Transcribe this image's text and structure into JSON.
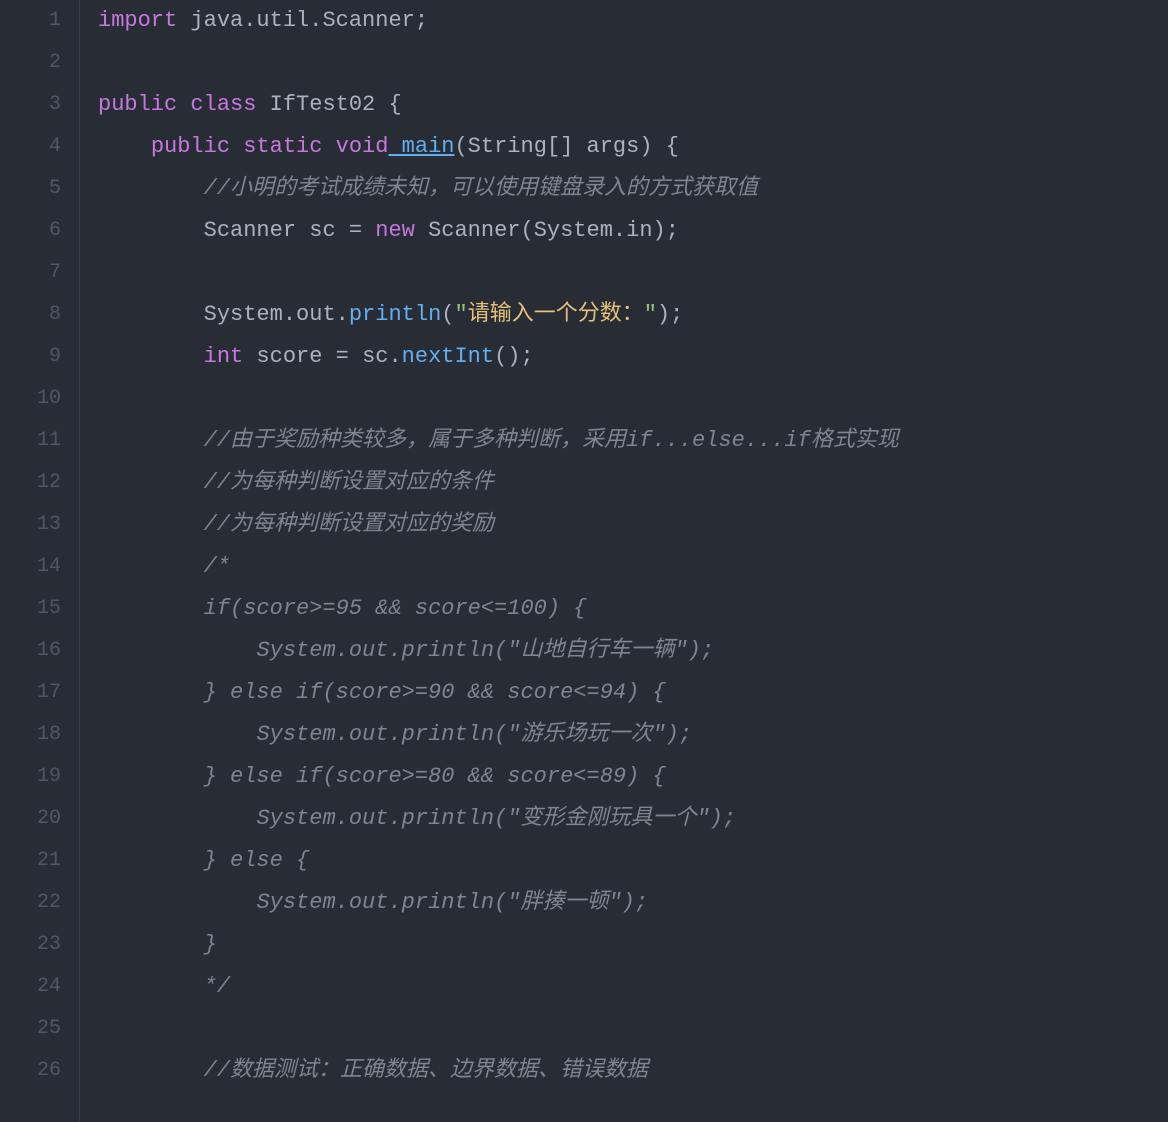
{
  "lines": [
    {
      "num": "1"
    },
    {
      "num": "2"
    },
    {
      "num": "3"
    },
    {
      "num": "4"
    },
    {
      "num": "5"
    },
    {
      "num": "6"
    },
    {
      "num": "7"
    },
    {
      "num": "8"
    },
    {
      "num": "9"
    },
    {
      "num": "10"
    },
    {
      "num": "11"
    },
    {
      "num": "12"
    },
    {
      "num": "13"
    },
    {
      "num": "14"
    },
    {
      "num": "15"
    },
    {
      "num": "16"
    },
    {
      "num": "17"
    },
    {
      "num": "18"
    },
    {
      "num": "19"
    },
    {
      "num": "20"
    },
    {
      "num": "21"
    },
    {
      "num": "22"
    },
    {
      "num": "23"
    },
    {
      "num": "24"
    },
    {
      "num": "25"
    },
    {
      "num": "26"
    }
  ],
  "code": {
    "l1": {
      "import": "import",
      "pkg": " java.util.Scanner;"
    },
    "l2": {
      "content": ""
    },
    "l3": {
      "public": "public",
      "class": " class",
      "name": " IfTest02",
      "brace": " {"
    },
    "l4": {
      "indent": "    ",
      "public": "public",
      "static": " static",
      "void": " void",
      "main": " main",
      "args": "(String[] args) {"
    },
    "l5": {
      "indent": "        ",
      "comment": "//小明的考试成绩未知，可以使用键盘录入的方式获取值"
    },
    "l6": {
      "indent": "        ",
      "type": "Scanner",
      "var": " sc",
      "eq": " = ",
      "new": "new",
      "ctor": " Scanner",
      "paren": "(System.in);"
    },
    "l7": {
      "content": ""
    },
    "l8": {
      "indent": "        ",
      "sys": "System.out.",
      "println": "println",
      "open": "(",
      "q1": "\"",
      "str": "请输入一个分数：",
      "q2": "\"",
      "close": ");"
    },
    "l9": {
      "indent": "        ",
      "int": "int",
      "var": " score",
      "eq": " = ",
      "sc": "sc.",
      "nextInt": "nextInt",
      "end": "();"
    },
    "l10": {
      "content": ""
    },
    "l11": {
      "indent": "        ",
      "comment": "//由于奖励种类较多，属于多种判断，采用if...else...if格式实现"
    },
    "l12": {
      "indent": "        ",
      "comment": "//为每种判断设置对应的条件"
    },
    "l13": {
      "indent": "        ",
      "comment": "//为每种判断设置对应的奖励"
    },
    "l14": {
      "indent": "        ",
      "comment": "/*"
    },
    "l15": {
      "indent": "        ",
      "comment": "if(score>=95 && score<=100) {"
    },
    "l16": {
      "indent": "            ",
      "comment": "System.out.println(\"山地自行车一辆\");"
    },
    "l17": {
      "indent": "        ",
      "comment": "} else if(score>=90 && score<=94) {"
    },
    "l18": {
      "indent": "            ",
      "comment": "System.out.println(\"游乐场玩一次\");"
    },
    "l19": {
      "indent": "        ",
      "comment": "} else if(score>=80 && score<=89) {"
    },
    "l20": {
      "indent": "            ",
      "comment": "System.out.println(\"变形金刚玩具一个\");"
    },
    "l21": {
      "indent": "        ",
      "comment": "} else {"
    },
    "l22": {
      "indent": "            ",
      "comment": "System.out.println(\"胖揍一顿\");"
    },
    "l23": {
      "indent": "        ",
      "comment": "}"
    },
    "l24": {
      "indent": "        ",
      "comment": "*/"
    },
    "l25": {
      "content": ""
    },
    "l26": {
      "indent": "        ",
      "comment": "//数据测试：正确数据、边界数据、错误数据"
    }
  }
}
